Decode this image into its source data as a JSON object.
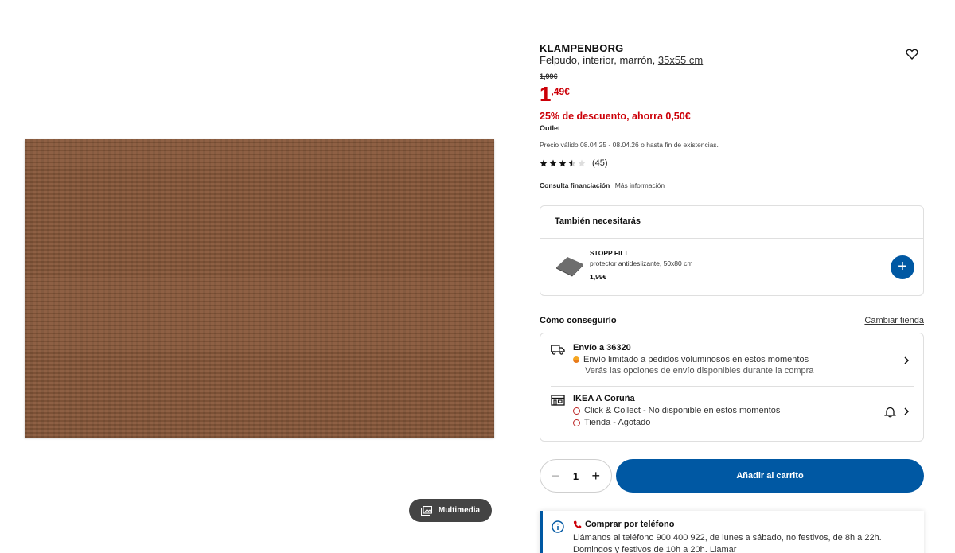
{
  "product": {
    "name": "KLAMPENBORG",
    "description": "Felpudo, interior, marrón,",
    "size": "35x55 cm",
    "old_price": "1,99€",
    "price_int": "1",
    "price_dec": ",49€",
    "discount": "25% de descuento, ahorra 0,50€",
    "outlet": "Outlet",
    "validity": "Precio válido 08.04.25 - 08.04.26 o hasta fin de existencias.",
    "rating": 3.5,
    "rating_count": "(45)",
    "finance_label": "Consulta financiación",
    "finance_link": "Más información"
  },
  "media": {
    "multimedia_label": "Multimedia"
  },
  "also_need": {
    "title": "También necesitarás",
    "item_name": "STOPP FILT",
    "item_desc": "protector antideslizante, 50x80 cm",
    "item_price": "1,99€"
  },
  "availability": {
    "title": "Cómo conseguirlo",
    "change_store": "Cambiar tienda",
    "delivery_title": "Envío a 36320",
    "delivery_line1": "Envío limitado a pedidos voluminosos en estos momentos",
    "delivery_line2": "Verás las opciones de envío disponibles durante la compra",
    "store_title": "IKEA A Coruña",
    "store_line1": "Click & Collect - No disponible en estos momentos",
    "store_line2": "Tienda - Agotado"
  },
  "purchase": {
    "quantity": "1",
    "add_to_cart": "Añadir al carrito"
  },
  "phone": {
    "title": "Comprar por teléfono",
    "text": "Llámanos al teléfono 900 400 922, de lunes a sábado, no festivos, de 8h a 22h. Domingos y festivos de 10h a 20h. Llamar"
  },
  "colors": {
    "accent": "#0058a3",
    "sale": "#cc0008",
    "mat": "#8a5a3c"
  }
}
